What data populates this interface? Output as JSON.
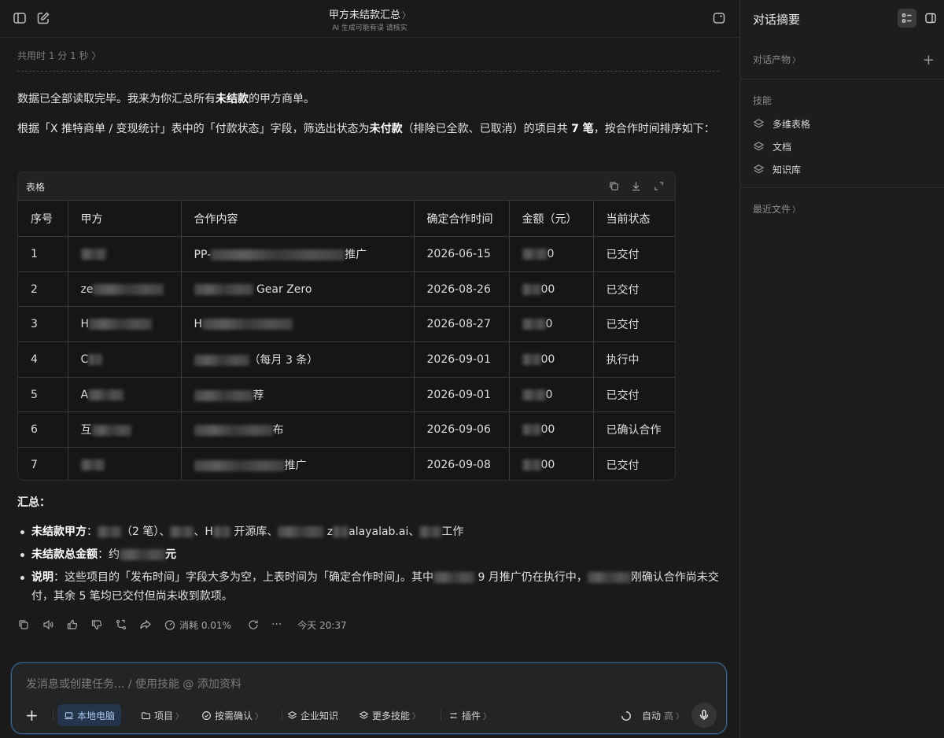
{
  "header": {
    "title": "甲方未结款汇总",
    "title_chevron": "〉",
    "subtitle": "AI 生成可能有误 请核实"
  },
  "duration": "共用时 1 分 1 秒 〉",
  "intro_parts": [
    "数据已全部读取完毕。我来为你汇总所有",
    "未结款",
    "的甲方商单。"
  ],
  "desc_parts": [
    "根据「X 推特商单 / 变现统计」表中的「付款状态」字段，筛选出状态为",
    "未付款",
    "（排除已全款、已取消）的项目共 ",
    "7 笔",
    "，按合作时间排序如下："
  ],
  "table": {
    "label": "表格",
    "columns": [
      "序号",
      "甲方",
      "合作内容",
      "确定合作时间",
      "金额（元）",
      "当前状态"
    ],
    "rows": [
      {
        "no": "1",
        "party": "",
        "content_prefix": "PP-",
        "content_suffix": "推广",
        "date": "2026-06-15",
        "amount_suffix": "0",
        "status": "已交付"
      },
      {
        "no": "2",
        "party": "ze",
        "content_prefix": "",
        "content_suffix": "Gear Zero",
        "date": "2026-08-26",
        "amount_suffix": "00",
        "status": "已交付"
      },
      {
        "no": "3",
        "party": "H",
        "content_prefix": "H",
        "content_suffix": "",
        "date": "2026-08-27",
        "amount_suffix": "0",
        "status": "已交付"
      },
      {
        "no": "4",
        "party": "C",
        "content_prefix": "",
        "content_suffix": "（每月 3 条）",
        "date": "2026-09-01",
        "amount_suffix": "00",
        "status": "执行中"
      },
      {
        "no": "5",
        "party": "A",
        "content_prefix": "",
        "content_suffix": "荐",
        "date": "2026-09-01",
        "amount_suffix": "0",
        "status": "已交付"
      },
      {
        "no": "6",
        "party": "互",
        "content_prefix": "",
        "content_suffix": "布",
        "date": "2026-09-06",
        "amount_suffix": "00",
        "status": "已确认合作"
      },
      {
        "no": "7",
        "party": "",
        "content_prefix": "",
        "content_suffix": "推广",
        "date": "2026-09-08",
        "amount_suffix": "00",
        "status": "已交付"
      }
    ]
  },
  "summary": {
    "heading": "汇总：",
    "item1_label": "未结款甲方",
    "item1_a": "：",
    "item1_b": "（2 笔）、",
    "item1_c": "、H",
    "item1_d": " 开源库、",
    "item1_e": "z",
    "item1_f": "alayalab.ai、",
    "item1_g": "工作",
    "item2_label": "未结款总金额",
    "item2_a": "：约",
    "item2_b": "元",
    "item3_label": "说明",
    "item3_a": "：这些项目的「发布时间」字段大多为空，上表时间为「确定合作时间」。其中",
    "item3_b": " 9 月推广仍在执行中，",
    "item3_c": "刚确认合作尚未交付，其余 5 笔均已交付但尚未收到款项。"
  },
  "actions": {
    "cost": "消耗 0.01%",
    "time": "今天 20:37",
    "more": "···"
  },
  "composer": {
    "placeholder": "发消息或创建任务... / 使用技能 @ 添加资料",
    "local": "本地电脑",
    "project": "项目",
    "confirm": "按需确认",
    "knowledge": "企业知识",
    "more_skills": "更多技能",
    "plugins": "插件",
    "mode": "自动",
    "level": "高",
    "chevron": "〉"
  },
  "sidebar": {
    "title": "对话摘要",
    "artifacts": "对话产物",
    "skills_label": "技能",
    "skills": [
      "多维表格",
      "文档",
      "知识库"
    ],
    "recent": "最近文件",
    "chevron": "〉"
  }
}
